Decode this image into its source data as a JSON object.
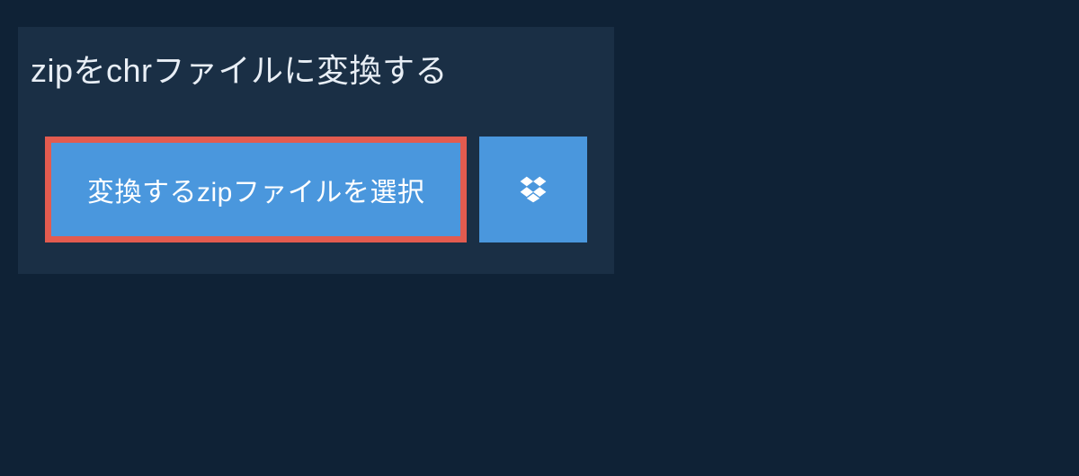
{
  "title": "zipをchrファイルに変換する",
  "buttons": {
    "select_file_label": "変換するzipファイルを選択"
  },
  "colors": {
    "background": "#0f2236",
    "panel": "#1a2f45",
    "button": "#4a97dd",
    "highlight_border": "#e35b4f",
    "text": "#e8eef5"
  }
}
